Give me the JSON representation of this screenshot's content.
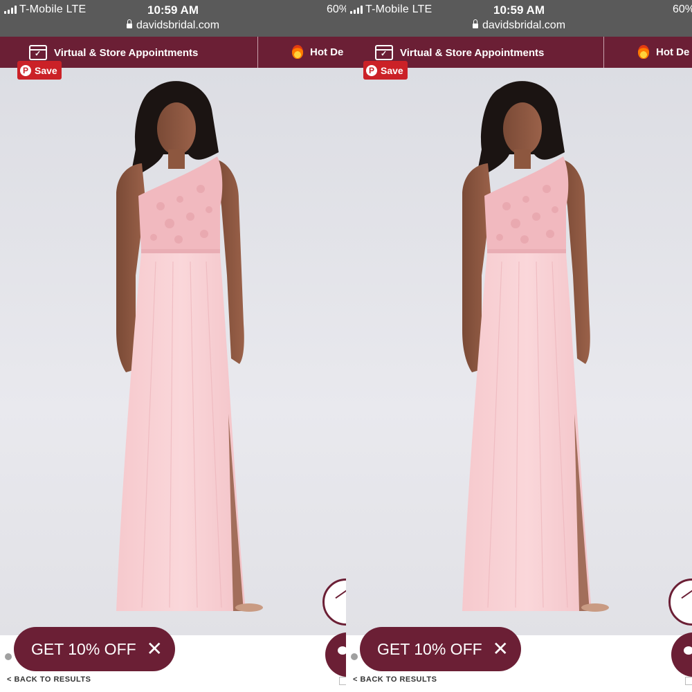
{
  "status_bar": {
    "carrier": "T-Mobile  LTE",
    "time": "10:59 AM",
    "url": "davidsbridal.com",
    "battery": "60%"
  },
  "promo_nav": {
    "appointments_label": "Virtual & Store Appointments",
    "hot_deals_label": "Hot De",
    "accent_color": "#6b1f35"
  },
  "product": {
    "save_label": "Save",
    "image_alt": "Model wearing a long pink one-shoulder lace bridesmaid dress"
  },
  "offer": {
    "label": "GET 10% OFF",
    "close_glyph": "✕"
  },
  "nav": {
    "back_label": "< BACK TO RESULTS"
  },
  "icons": [
    "calendar-icon",
    "flame-icon",
    "pinterest-icon",
    "close-icon",
    "scroll-top-icon",
    "chat-icon",
    "lock-icon"
  ]
}
